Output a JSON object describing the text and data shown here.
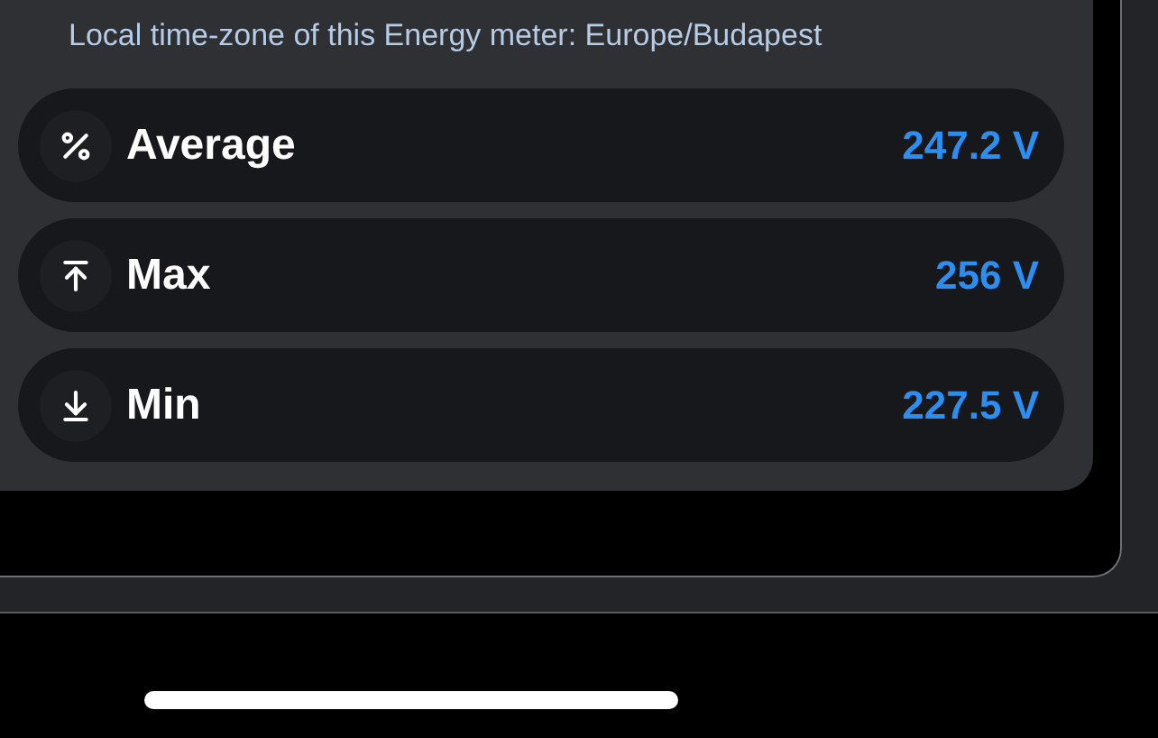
{
  "timezone_note": "Local time-zone of this Energy meter: Europe/Budapest",
  "stats": [
    {
      "kind": "average",
      "label": "Average",
      "value": "247.2 V"
    },
    {
      "kind": "max",
      "label": "Max",
      "value": "256 V"
    },
    {
      "kind": "min",
      "label": "Min",
      "value": "227.5 V"
    }
  ]
}
